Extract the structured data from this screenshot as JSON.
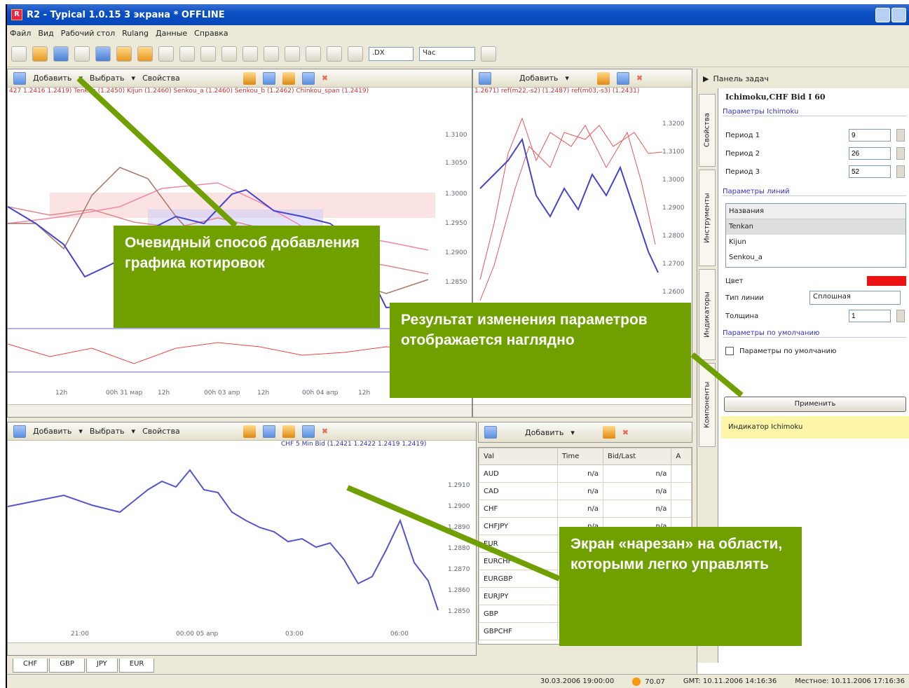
{
  "window": {
    "title": "R2 - Typical 1.0.15 3 экрана * OFFLINE"
  },
  "menu": [
    "Файл",
    "Вид",
    "Рабочий стол",
    "Rulang",
    "Данные",
    "Справка"
  ],
  "toolbar": {
    "period_select": ".DX",
    "timeframe_select": "Час"
  },
  "chart_top_left": {
    "toolbar": {
      "add": "Добавить",
      "select": "Выбрать",
      "props": "Свойства"
    },
    "legend": "427 1.2416 1.2419)   Tenkan (1.2450)   Kijun (1.2460)   Senkou_a (1.2460)   Senkou_b (1.2462)   Chinkou_span (1.2419)",
    "yticks": [
      "1.3100",
      "1.3050",
      "1.3000",
      "1.2950",
      "1.2900",
      "1.2850"
    ],
    "xticks": [
      "12h",
      "00h 31 мар",
      "12h",
      "00h 03 апр",
      "12h",
      "00h 04 апр",
      "12h"
    ]
  },
  "chart_top_right": {
    "toolbar": {
      "add": "Добавить"
    },
    "legend": "1.2671)   ref(m22,-s2) (1.2487)   ref(m03,-s3) (1.2431)",
    "yticks": [
      "1.3200",
      "1.3100",
      "1.3000",
      "1.2900",
      "1.2800",
      "1.2700",
      "1.2600"
    ]
  },
  "chart_bottom_left": {
    "toolbar": {
      "add": "Добавить",
      "select": "Выбрать",
      "props": "Свойства"
    },
    "legend": "CHF 5 Min Bid (1.2421 1.2422 1.2419 1.2419)",
    "yticks": [
      "1.2910",
      "1.2900",
      "1.2890",
      "1.2880",
      "1.2870",
      "1.2860",
      "1.2850"
    ],
    "xticks": [
      "21:00",
      "00:00 05 апр",
      "03:00",
      "06:00"
    ]
  },
  "watchlist": {
    "toolbar": {
      "add": "Добавить"
    },
    "columns": [
      "Val",
      "Time",
      "Bid/Last",
      "A"
    ],
    "rows": [
      [
        "AUD",
        "n/a",
        "n/a"
      ],
      [
        "CAD",
        "n/a",
        "n/a"
      ],
      [
        "CHF",
        "n/a",
        "n/a"
      ],
      [
        "CHFJPY",
        "n/a",
        "n/a"
      ],
      [
        "EUR",
        "",
        ""
      ],
      [
        "EURCHF",
        "",
        ""
      ],
      [
        "EURGBP",
        "",
        ""
      ],
      [
        "EURJPY",
        "",
        ""
      ],
      [
        "GBP",
        "",
        ""
      ],
      [
        "GBPCHF",
        "",
        ""
      ]
    ]
  },
  "bottom_tabs": [
    "CHF",
    "GBP",
    "JPY",
    "EUR"
  ],
  "taskpane": {
    "title": "Панель задач",
    "vtabs": [
      "Свойства",
      "Инструменты",
      "Индикаторы",
      "Компоненты"
    ],
    "header": "Ichimoku,CHF Bid I 60",
    "group_params": "Параметры Ichimoku",
    "params": [
      {
        "label": "Период 1",
        "value": "9"
      },
      {
        "label": "Период 2",
        "value": "26"
      },
      {
        "label": "Период 3",
        "value": "52"
      }
    ],
    "group_lines": "Параметры линий",
    "lines_header": "Названия",
    "lines": [
      "Tenkan",
      "Kijun",
      "Senkou_a"
    ],
    "color_label": "Цвет",
    "color": "#ee1111",
    "linetype_label": "Тип линии",
    "linetype_value": "Сплошная",
    "thickness_label": "Толщина",
    "thickness_value": "1",
    "group_default": "Параметры по умолчанию",
    "default_checkbox": "Параметры по умолчанию",
    "apply": "Применить",
    "indicator": "Индикатор Ichimoku"
  },
  "status": {
    "datetime": "30.03.2006 19:00:00",
    "value": "70.07",
    "gmt": "GMT: 10.11.2006 14:16:36",
    "local": "Местное: 10.11.2006 17:16:36"
  },
  "callouts": {
    "add_chart": "Очевидный способ добавления графика котировок",
    "params_result": "Результат изменения параметров отображается наглядно",
    "screen_split": "Экран «нарезан» на области, которыми легко управлять"
  }
}
